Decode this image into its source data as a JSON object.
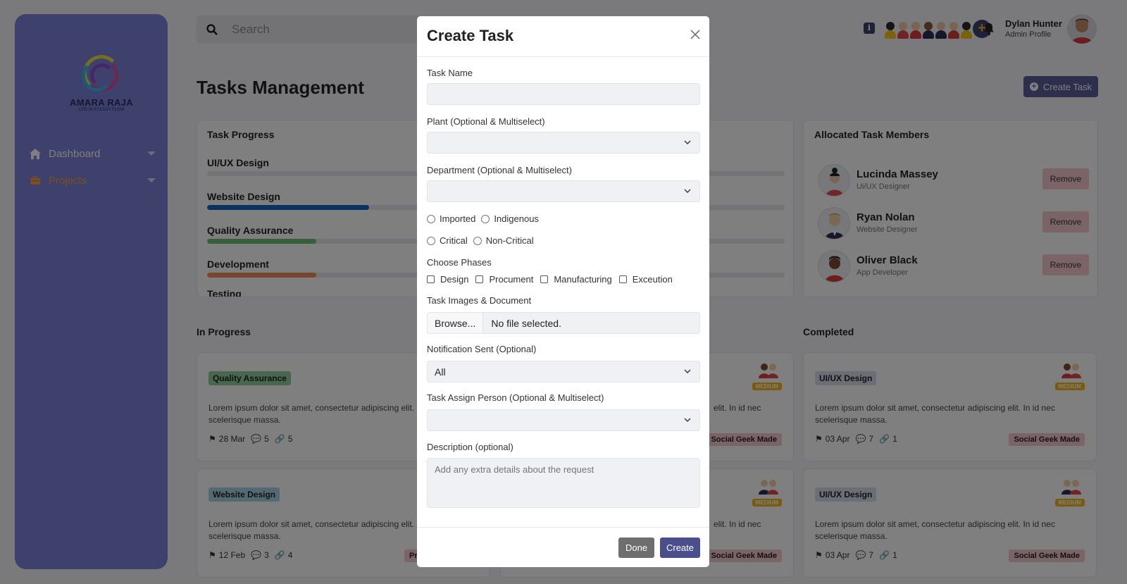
{
  "sidebar": {
    "logo_text": "AMARA RAJA",
    "logo_sub": "LIFE IN STEADY FLOW",
    "items": [
      {
        "label": "Dashboard",
        "icon": "home-icon"
      },
      {
        "label": "Projects",
        "icon": "briefcase-icon"
      }
    ]
  },
  "topbar": {
    "search_placeholder": "Search",
    "user_name": "Dylan Hunter",
    "user_role": "Admin Profile"
  },
  "page": {
    "title": "Tasks Management",
    "create_button": "Create Task"
  },
  "task_progress": {
    "title": "Task Progress",
    "items": [
      {
        "label": "UI/UX Design",
        "progress": 0.0,
        "color": "#c9c9e8"
      },
      {
        "label": "Website Design",
        "progress": 0.28,
        "color": "#1565c0"
      },
      {
        "label": "Quality Assurance",
        "progress": 0.186,
        "color": "#6fbf7c"
      },
      {
        "label": "Development",
        "progress": 0.186,
        "color": "#f08b5a"
      },
      {
        "label": "Testing",
        "progress": 0.0,
        "color": "#e8e9ee"
      }
    ]
  },
  "members": {
    "title": "Allocated Task Members",
    "remove_label": "Remove",
    "list": [
      {
        "name": "Lucinda Massey",
        "role": "Ui/UX Designer"
      },
      {
        "name": "Ryan Nolan",
        "role": "Website Designer"
      },
      {
        "name": "Oliver Black",
        "role": "App Developer"
      }
    ]
  },
  "columns": {
    "in_progress": "In Progress",
    "completed": "Completed"
  },
  "cards": {
    "in_progress": [
      {
        "tag": "Quality Assurance",
        "tag_color": "#8fd19e",
        "desc": "Lorem ipsum dolor sit amet, consectetur adipiscing elit. In id nec scelerisque massa.",
        "date": "28 Mar",
        "comments": "5",
        "links": "5"
      },
      {
        "tag": "Website Design",
        "tag_color": "#a7d4e4",
        "desc": "Lorem ipsum dolor sit amet, consectetur adipiscing elit. In id nec scelerisque massa.",
        "date": "12 Feb",
        "comments": "3",
        "links": "4",
        "who": "Pra"
      }
    ],
    "middle": [
      {
        "desc": "elit. In id nec",
        "prio": "MEDIUM",
        "who": "Social Geek Made"
      },
      {
        "desc": "elit. In id nec",
        "prio": "MEDIUM",
        "who": "Social Geek Made"
      }
    ],
    "completed": [
      {
        "tag": "UI/UX Design",
        "tag_color": "#d9dbee",
        "desc": "Lorem ipsum dolor sit amet, consectetur adipiscing elit. In id nec scelerisque massa.",
        "date": "03 Apr",
        "comments": "7",
        "links": "1",
        "prio": "MEDIUM",
        "who": "Social Geek Made"
      },
      {
        "tag": "UI/UX Design",
        "tag_color": "#d9dbee",
        "desc": "Lorem ipsum dolor sit amet, consectetur adipiscing elit. In id nec scelerisque massa.",
        "date": "03 Apr",
        "comments": "7",
        "links": "1",
        "prio": "MEDIUM",
        "who": "Social Geek Made"
      }
    ]
  },
  "modal": {
    "title": "Create Task",
    "task_name_label": "Task Name",
    "task_name_value": "",
    "plant_label": "Plant (Optional & Multiselect)",
    "department_label": "Department (Optional & Multiselect)",
    "origin_options": [
      "Imported",
      "Indigenous"
    ],
    "criticality_options": [
      "Critical",
      "Non-Critical"
    ],
    "phases_label": "Choose Phases",
    "phases": [
      "Design",
      "Procument",
      "Manufacturing",
      "Exceution"
    ],
    "images_label": "Task Images & Document",
    "browse_label": "Browse...",
    "file_status": "No file selected.",
    "notification_label": "Notification Sent (Optional)",
    "notification_value": "All",
    "assign_label": "Task Assign Person (Optional & Multiselect)",
    "description_label": "Description (optional)",
    "description_placeholder": "Add any extra details about the request",
    "done_label": "Done",
    "create_label": "Create"
  }
}
